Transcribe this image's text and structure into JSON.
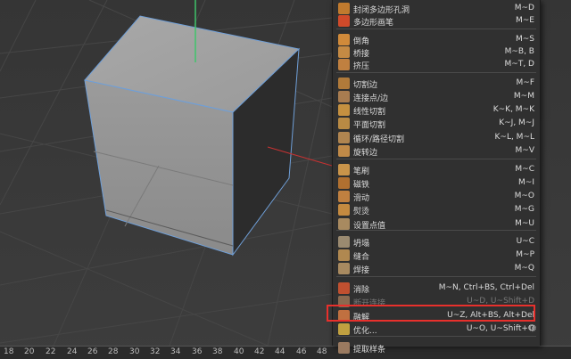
{
  "ruler": {
    "ticks": [
      "18",
      "20",
      "22",
      "24",
      "26",
      "28",
      "30",
      "32",
      "34",
      "36",
      "38",
      "40",
      "42",
      "44",
      "46",
      "48"
    ]
  },
  "menu": {
    "items": [
      {
        "label": "封闭多边形孔洞",
        "shortcut": "M~D",
        "icon_color": "#c07a2e",
        "icon": "close-polygon-hole-icon"
      },
      {
        "label": "多边形画笔",
        "shortcut": "M~E",
        "icon_color": "#d04a2a",
        "icon": "polygon-pen-icon"
      },
      {
        "label": "倒角",
        "shortcut": "M~S",
        "icon_color": "#d08a3a",
        "icon": "bevel-icon"
      },
      {
        "label": "桥接",
        "shortcut": "M~B, B",
        "icon_color": "#c48a44",
        "icon": "bridge-icon"
      },
      {
        "label": "挤压",
        "shortcut": "M~T, D",
        "icon_color": "#c08040",
        "icon": "extrude-icon"
      },
      {
        "label": "切割边",
        "shortcut": "M~F",
        "icon_color": "#b07a3a",
        "icon": "edge-cut-icon"
      },
      {
        "label": "连接点/边",
        "shortcut": "M~M",
        "icon_color": "#a87c50",
        "icon": "connect-points-edges-icon"
      },
      {
        "label": "线性切割",
        "shortcut": "K~K, M~K",
        "icon_color": "#c49040",
        "icon": "line-cut-icon"
      },
      {
        "label": "平面切割",
        "shortcut": "K~J, M~J",
        "icon_color": "#b88a44",
        "icon": "plane-cut-icon"
      },
      {
        "label": "循环/路径切割",
        "shortcut": "K~L, M~L",
        "icon_color": "#b08550",
        "icon": "loop-path-cut-icon"
      },
      {
        "label": "旋转边",
        "shortcut": "M~V",
        "icon_color": "#c08a48",
        "icon": "spin-edge-icon"
      },
      {
        "label": "笔刷",
        "shortcut": "M~C",
        "icon_color": "#c9944a",
        "icon": "brush-icon"
      },
      {
        "label": "磁铁",
        "shortcut": "M~I",
        "icon_color": "#b07030",
        "icon": "magnet-icon"
      },
      {
        "label": "滑动",
        "shortcut": "M~O",
        "icon_color": "#c08040",
        "icon": "slide-icon"
      },
      {
        "label": "熨烫",
        "shortcut": "M~G",
        "icon_color": "#c48a40",
        "icon": "iron-icon"
      },
      {
        "label": "设置点值",
        "shortcut": "M~U",
        "icon_color": "#a88a60",
        "icon": "set-point-value-icon"
      },
      {
        "label": "坍塌",
        "shortcut": "U~C",
        "icon_color": "#9a8a70",
        "icon": "collapse-icon"
      },
      {
        "label": "缝合",
        "shortcut": "M~P",
        "icon_color": "#b08850",
        "icon": "stitch-and-sew-icon"
      },
      {
        "label": "焊接",
        "shortcut": "M~Q",
        "icon_color": "#a88a60",
        "icon": "weld-icon"
      },
      {
        "label": "消除",
        "shortcut": "M~N, Ctrl+BS, Ctrl+Del",
        "icon_color": "#c05030",
        "icon": "dissolve-icon"
      },
      {
        "label": "断开连接",
        "shortcut": "U~D, U~Shift+D",
        "icon_color": "#8a6a50",
        "icon": "disconnect-icon",
        "disabled": true
      },
      {
        "label": "融解",
        "shortcut": "U~Z, Alt+BS, Alt+Del",
        "icon_color": "#c07040",
        "icon": "melt-icon"
      },
      {
        "label": "优化...",
        "shortcut": "U~O, U~Shift+O",
        "icon_color": "#c0a040",
        "icon": "optimize-icon"
      },
      {
        "label": "提取样条",
        "shortcut": "",
        "icon_color": "#9a7a60",
        "icon": "extract-spline-icon"
      }
    ],
    "gear_icon": "gear-icon"
  },
  "colors": {
    "highlight_box": "#e8302c",
    "arrow": "#e8302c",
    "axis_y": "#3ec46a",
    "axis_x": "#c83232",
    "cube_edge": "#6f9fd8"
  }
}
